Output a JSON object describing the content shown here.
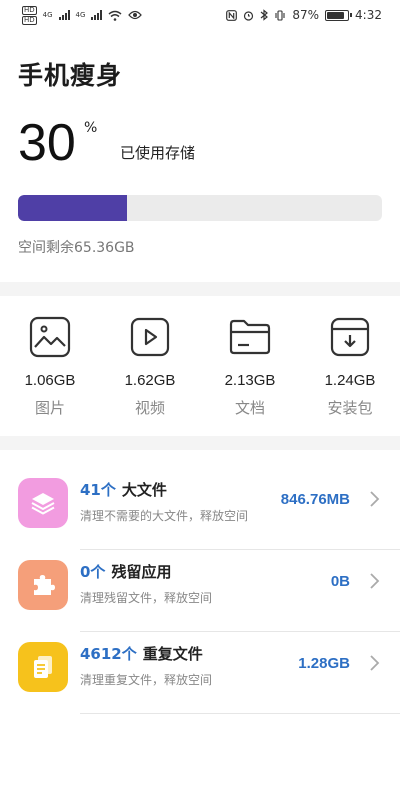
{
  "status_bar": {
    "left_badges": [
      "HD",
      "HD",
      "4G",
      "4G"
    ],
    "battery_percent": "87%",
    "battery_level": 0.87,
    "time": "4:32"
  },
  "page": {
    "title": "手机瘦身",
    "usage_value": "30",
    "usage_unit": "%",
    "usage_label": "已使用存储",
    "usage_fraction": 0.3,
    "remaining": "空间剩余65.36GB"
  },
  "categories": [
    {
      "size": "1.06GB",
      "name": "图片",
      "icon": "image-icon"
    },
    {
      "size": "1.62GB",
      "name": "视频",
      "icon": "video-icon"
    },
    {
      "size": "2.13GB",
      "name": "文档",
      "icon": "folder-icon"
    },
    {
      "size": "1.24GB",
      "name": "安装包",
      "icon": "package-icon"
    }
  ],
  "items": [
    {
      "count": "41个",
      "title": "大文件",
      "desc": "清理不需要的大文件，释放空间",
      "size": "846.76MB",
      "icon": "layers-icon",
      "color": "#f29ce0"
    },
    {
      "count": "0个",
      "title": "残留应用",
      "desc": "清理残留文件，释放空间",
      "size": "0B",
      "icon": "puzzle-icon",
      "color": "#f59f7a"
    },
    {
      "count": "4612个",
      "title": "重复文件",
      "desc": "清理重复文件，释放空间",
      "size": "1.28GB",
      "icon": "documents-icon",
      "color": "#f6c21c"
    }
  ],
  "colors": {
    "accent": "#4f3fa6",
    "link": "#2d6fc4"
  }
}
